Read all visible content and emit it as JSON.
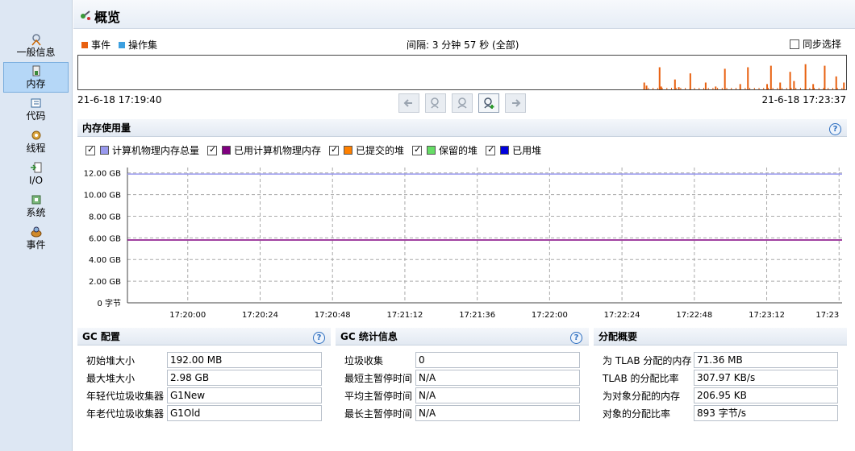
{
  "sidebar": {
    "items": [
      {
        "label": "一般信息",
        "icon": "general-info-icon",
        "active": false
      },
      {
        "label": "内存",
        "icon": "memory-icon",
        "active": true
      },
      {
        "label": "代码",
        "icon": "code-icon",
        "active": false
      },
      {
        "label": "线程",
        "icon": "threads-icon",
        "active": false
      },
      {
        "label": "I/O",
        "icon": "io-icon",
        "active": false
      },
      {
        "label": "系统",
        "icon": "system-icon",
        "active": false
      },
      {
        "label": "事件",
        "icon": "events-icon",
        "active": false
      }
    ]
  },
  "header": {
    "title": "概览",
    "icon": "overview-icon"
  },
  "timeline": {
    "legend": [
      {
        "label": "事件",
        "color": "#e8600f"
      },
      {
        "label": "操作集",
        "color": "#3da0e0"
      }
    ],
    "interval": "间隔: 3 分钟 57 秒 (全部)",
    "sync_label": "同步选择",
    "start": "21-6-18 17:19:40",
    "end": "21-6-18 17:23:37",
    "events_color": "#e8600f",
    "event_spikes": [
      {
        "pos": 0.735,
        "h": 0.25
      },
      {
        "pos": 0.738,
        "h": 0.15
      },
      {
        "pos": 0.755,
        "h": 0.75
      },
      {
        "pos": 0.757,
        "h": 0.12
      },
      {
        "pos": 0.775,
        "h": 0.35
      },
      {
        "pos": 0.78,
        "h": 0.1
      },
      {
        "pos": 0.795,
        "h": 0.55
      },
      {
        "pos": 0.815,
        "h": 0.25
      },
      {
        "pos": 0.828,
        "h": 0.12
      },
      {
        "pos": 0.84,
        "h": 0.7
      },
      {
        "pos": 0.86,
        "h": 0.2
      },
      {
        "pos": 0.87,
        "h": 0.75
      },
      {
        "pos": 0.895,
        "h": 0.2
      },
      {
        "pos": 0.9,
        "h": 0.8
      },
      {
        "pos": 0.912,
        "h": 0.25
      },
      {
        "pos": 0.925,
        "h": 0.6
      },
      {
        "pos": 0.93,
        "h": 0.3
      },
      {
        "pos": 0.945,
        "h": 0.85
      },
      {
        "pos": 0.955,
        "h": 0.2
      },
      {
        "pos": 0.97,
        "h": 0.8
      },
      {
        "pos": 0.985,
        "h": 0.45
      },
      {
        "pos": 0.995,
        "h": 0.25
      }
    ],
    "buttons": [
      {
        "name": "scroll-left-button",
        "icon": "arrow-left-icon",
        "enabled": false
      },
      {
        "name": "zoom-out-button",
        "icon": "zoom-out-icon",
        "enabled": false
      },
      {
        "name": "zoom-reset-button",
        "icon": "zoom-reset-icon",
        "enabled": false
      },
      {
        "name": "zoom-in-button",
        "icon": "zoom-in-icon",
        "enabled": true
      },
      {
        "name": "scroll-right-button",
        "icon": "arrow-right-icon",
        "enabled": false
      }
    ]
  },
  "memory": {
    "title": "内存使用量",
    "help_label": "?",
    "legend": [
      {
        "label": "计算机物理内存总量",
        "color": "#9999ee",
        "checked": true
      },
      {
        "label": "已用计算机物理内存",
        "color": "#800080",
        "checked": true
      },
      {
        "label": "已提交的堆",
        "color": "#ff8000",
        "checked": true
      },
      {
        "label": "保留的堆",
        "color": "#66dd66",
        "checked": true
      },
      {
        "label": "已用堆",
        "color": "#0000dd",
        "checked": true
      }
    ]
  },
  "chart_data": {
    "type": "line",
    "title": "",
    "xlabel": "",
    "ylabel": "",
    "ylim": [
      0,
      12.5
    ],
    "yticks": [
      "0 字节",
      "2.00 GB",
      "4.00 GB",
      "6.00 GB",
      "8.00 GB",
      "10.00 GB",
      "12.00 GB"
    ],
    "ytick_values": [
      0,
      2,
      4,
      6,
      8,
      10,
      12
    ],
    "xticks": [
      "17:20:00",
      "17:20:24",
      "17:20:48",
      "17:21:12",
      "17:21:36",
      "17:22:00",
      "17:22:24",
      "17:22:48",
      "17:23:12",
      "17:23"
    ],
    "xlim_seconds": [
      0,
      237
    ],
    "xtick_seconds": [
      20,
      44,
      68,
      92,
      116,
      140,
      164,
      188,
      212,
      236
    ],
    "grid": true,
    "series": [
      {
        "name": "计算机物理内存总量",
        "color": "#9999ee",
        "x": [
          0,
          237
        ],
        "values": [
          11.9,
          11.9
        ]
      },
      {
        "name": "已用计算机物理内存",
        "color": "#800080",
        "x": [
          0,
          237
        ],
        "values": [
          5.8,
          5.8
        ]
      }
    ]
  },
  "gc_config": {
    "title": "GC 配置",
    "help_label": "?",
    "rows": [
      {
        "label": "初始堆大小",
        "value": "192.00 MB"
      },
      {
        "label": "最大堆大小",
        "value": "2.98 GB"
      },
      {
        "label": "年轻代垃圾收集器",
        "value": "G1New"
      },
      {
        "label": "年老代垃圾收集器",
        "value": "G1Old"
      }
    ]
  },
  "gc_stats": {
    "title": "GC 统计信息",
    "help_label": "?",
    "rows": [
      {
        "label": "垃圾收集",
        "value": "0"
      },
      {
        "label": "最短主暂停时间",
        "value": "N/A"
      },
      {
        "label": "平均主暂停时间",
        "value": "N/A"
      },
      {
        "label": "最长主暂停时间",
        "value": "N/A"
      }
    ]
  },
  "allocation": {
    "title": "分配概要",
    "rows": [
      {
        "label": "为 TLAB 分配的内存",
        "value": "71.36 MB"
      },
      {
        "label": "TLAB 的分配比率",
        "value": "307.97 KB/s"
      },
      {
        "label": "为对象分配的内存",
        "value": "206.95 KB"
      },
      {
        "label": "对象的分配比率",
        "value": "893 字节/s"
      }
    ]
  }
}
